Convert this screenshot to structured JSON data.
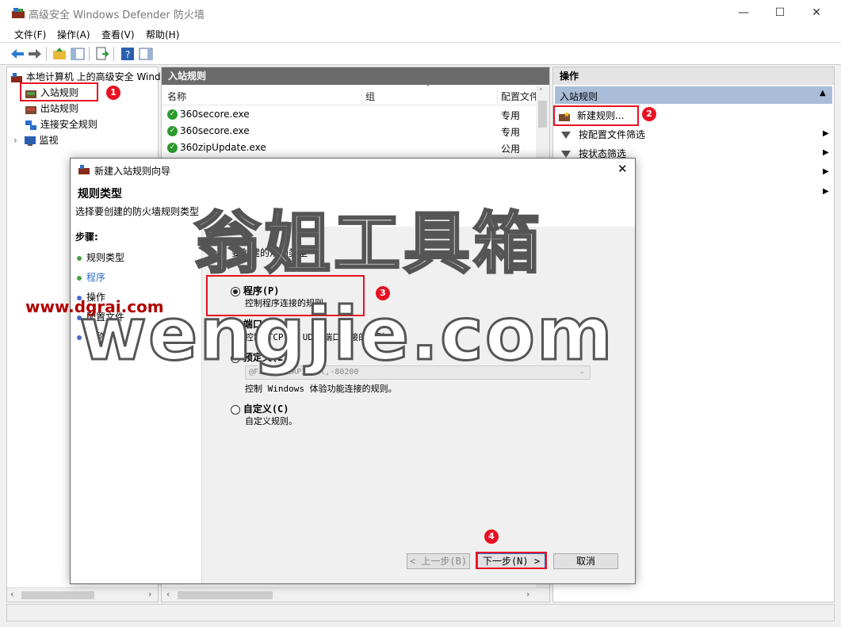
{
  "window": {
    "title": "高级安全 Windows Defender 防火墙",
    "minimize": "—",
    "maximize": "☐",
    "close": "✕"
  },
  "menu": [
    "文件(F)",
    "操作(A)",
    "查看(V)",
    "帮助(H)"
  ],
  "tree": {
    "root": "本地计算机 上的高级安全 Windo",
    "items": [
      "入站规则",
      "出站规则",
      "连接安全规则",
      "监视"
    ]
  },
  "center": {
    "header": "入站规则",
    "columns": [
      "名称",
      "组",
      "配置文件"
    ],
    "rows": [
      {
        "name": "360secore.exe",
        "profile": "专用"
      },
      {
        "name": "360secore.exe",
        "profile": "专用"
      },
      {
        "name": "360zipUpdate.exe",
        "profile": "公用"
      }
    ]
  },
  "actions": {
    "header": "操作",
    "section": "入站规则",
    "items": [
      "新建规则...",
      "按配置文件筛选",
      "按状态筛选"
    ]
  },
  "badges": [
    "1",
    "2",
    "3",
    "4"
  ],
  "dialog": {
    "title": "新建入站规则向导",
    "heading": "规则类型",
    "subheading": "选择要创建的防火墙规则类型",
    "steps_label": "步骤:",
    "steps": [
      "规则类型",
      "程序",
      "操作",
      "配置文件",
      "名称"
    ],
    "prompt": "要创建的规则类型",
    "options": [
      {
        "label": "程序(P)",
        "desc": "控制程序连接的规则。",
        "selected": true
      },
      {
        "label": "端口(O)",
        "desc": "控制 TCP 或 UDP 端口连接的规则。",
        "selected": false
      },
      {
        "label": "预定义(E):",
        "desc": "控制 Windows 体验功能连接的规则。",
        "selected": false,
        "select_value": "@FirewallAPI.dll,-80200"
      },
      {
        "label": "自定义(C)",
        "desc": "自定义规则。",
        "selected": false
      }
    ],
    "buttons": {
      "back": "< 上一步(B)",
      "next": "下一步(N) >",
      "cancel": "取消"
    }
  },
  "watermark": {
    "site": "www.dgrai.com",
    "cn": "翁姐工具箱",
    "en": "wengjie.com"
  },
  "colors": {
    "highlight": "#e81123",
    "panel_header": "#6b6b6b",
    "action_section": "#a9bcd8"
  }
}
